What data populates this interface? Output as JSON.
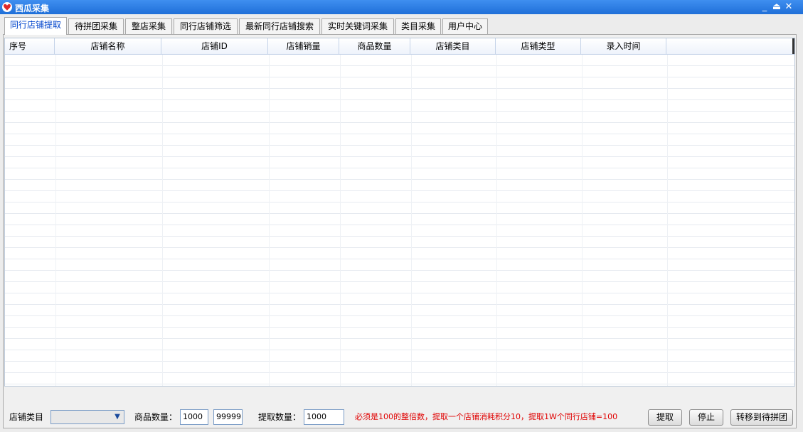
{
  "window": {
    "title": "西瓜采集",
    "controls": {
      "minimize": "_",
      "restore": "⏏",
      "close": "✕"
    }
  },
  "tabs": [
    {
      "label": "同行店铺提取",
      "active": true
    },
    {
      "label": "待拼团采集",
      "active": false
    },
    {
      "label": "整店采集",
      "active": false
    },
    {
      "label": "同行店铺筛选",
      "active": false
    },
    {
      "label": "最新同行店铺搜索",
      "active": false
    },
    {
      "label": "实时关键词采集",
      "active": false
    },
    {
      "label": "类目采集",
      "active": false
    },
    {
      "label": "用户中心",
      "active": false
    }
  ],
  "table": {
    "columns": [
      "序号",
      "店铺名称",
      "店铺ID",
      "店铺销量",
      "商品数量",
      "店铺类目",
      "店铺类型",
      "录入时间"
    ],
    "rows": []
  },
  "filters": {
    "category_label": "店铺类目",
    "category_value": "",
    "goods_count_label": "商品数量：",
    "goods_min": "1000",
    "goods_max": "99999",
    "extract_count_label": "提取数量：",
    "extract_count": "1000",
    "notice": "必须是100的整倍数，提取一个店铺消耗积分10，提取1W个同行店铺=100"
  },
  "buttons": {
    "extract": "提取",
    "stop": "停止",
    "move_to_group": "转移到待拼团"
  },
  "colors": {
    "title_bar": "#1f6fd8",
    "active_tab_text": "#0044cc",
    "notice_text": "#e00000"
  }
}
